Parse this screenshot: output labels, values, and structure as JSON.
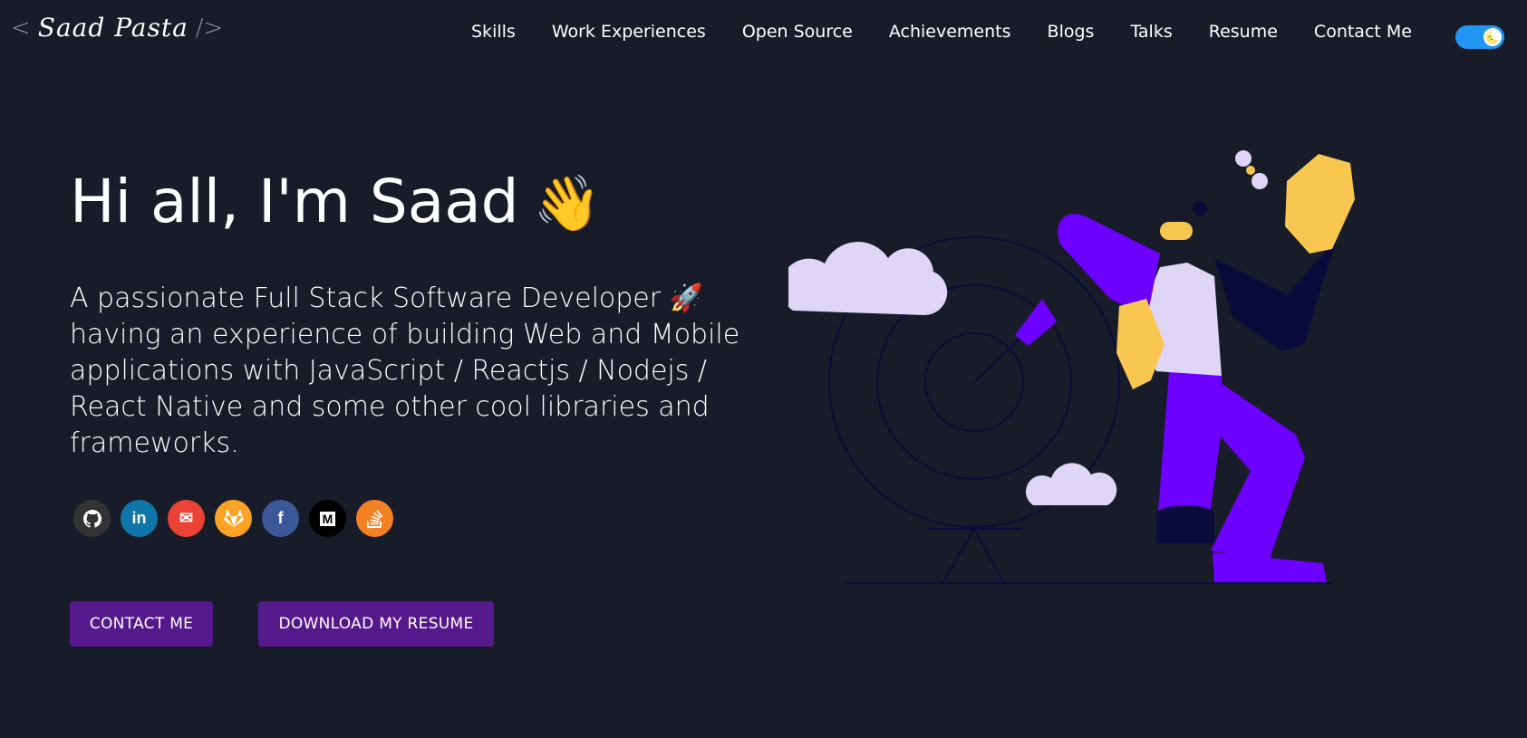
{
  "header": {
    "logo_open": "<",
    "logo_name": "Saad Pasta",
    "logo_close": "/>",
    "nav": [
      "Skills",
      "Work Experiences",
      "Open Source",
      "Achievements",
      "Blogs",
      "Talks",
      "Resume",
      "Contact Me"
    ],
    "theme_toggle_icon": "🌜"
  },
  "hero": {
    "title": "Hi all, I'm Saad",
    "wave_emoji": "👋",
    "subtitle": "A passionate Full Stack Software Developer 🚀 having an experience of building Web and Mobile applications with JavaScript / Reactjs / Nodejs / React Native and some other cool libraries and frameworks.",
    "socials": [
      {
        "name": "github-icon",
        "glyph": "",
        "color": "#333333"
      },
      {
        "name": "linkedin-icon",
        "glyph": "in",
        "color": "#0e76a8"
      },
      {
        "name": "gmail-icon",
        "glyph": "✉",
        "color": "#ea4335"
      },
      {
        "name": "gitlab-icon",
        "glyph": "",
        "color": "#fca326"
      },
      {
        "name": "facebook-icon",
        "glyph": "f",
        "color": "#3b5998"
      },
      {
        "name": "medium-icon",
        "glyph": "M",
        "color": "#000000"
      },
      {
        "name": "stackoverflow-icon",
        "glyph": "",
        "color": "#f48024"
      }
    ],
    "contact_button": "CONTACT ME",
    "resume_button": "DOWNLOAD MY RESUME"
  },
  "colors": {
    "background": "#171c28",
    "button": "#55198b",
    "toggle": "#2196f3",
    "accent_purple": "#6e00ff"
  }
}
